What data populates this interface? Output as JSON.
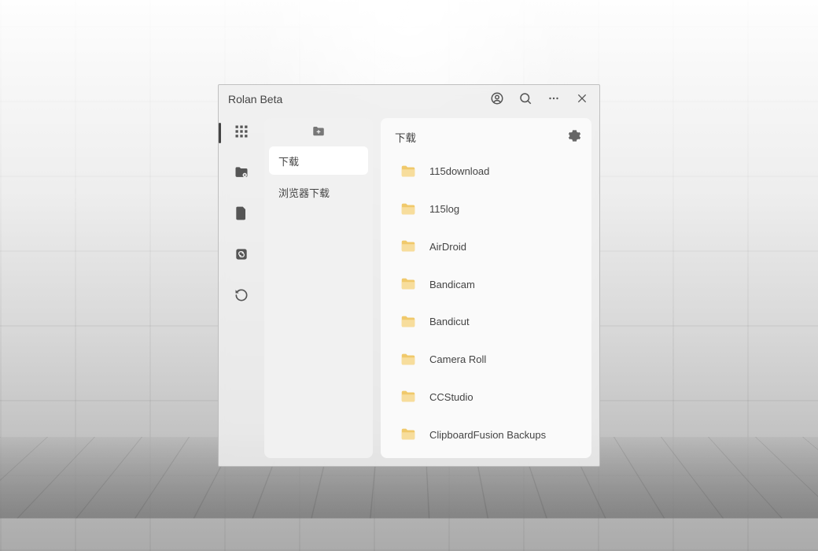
{
  "window": {
    "title": "Rolan Beta"
  },
  "titlebar_icons": {
    "account": "account-icon",
    "search": "search-icon",
    "more": "more-icon",
    "close": "close-icon"
  },
  "rail": [
    {
      "name": "apps-grid-icon",
      "active": true
    },
    {
      "name": "pinned-folder-icon",
      "active": false
    },
    {
      "name": "file-icon",
      "active": false
    },
    {
      "name": "link-icon",
      "active": false
    },
    {
      "name": "clock-icon",
      "active": false
    }
  ],
  "categories": {
    "add_label": "add-folder",
    "items": [
      {
        "label": "下载",
        "selected": true
      },
      {
        "label": "浏览器下载",
        "selected": false
      }
    ]
  },
  "content": {
    "header": "下载",
    "settings_icon": "gear-icon",
    "folders": [
      {
        "name": "115download"
      },
      {
        "name": "115log"
      },
      {
        "name": "AirDroid"
      },
      {
        "name": "Bandicam"
      },
      {
        "name": "Bandicut"
      },
      {
        "name": "Camera Roll"
      },
      {
        "name": "CCStudio"
      },
      {
        "name": "ClipboardFusion Backups"
      }
    ]
  }
}
